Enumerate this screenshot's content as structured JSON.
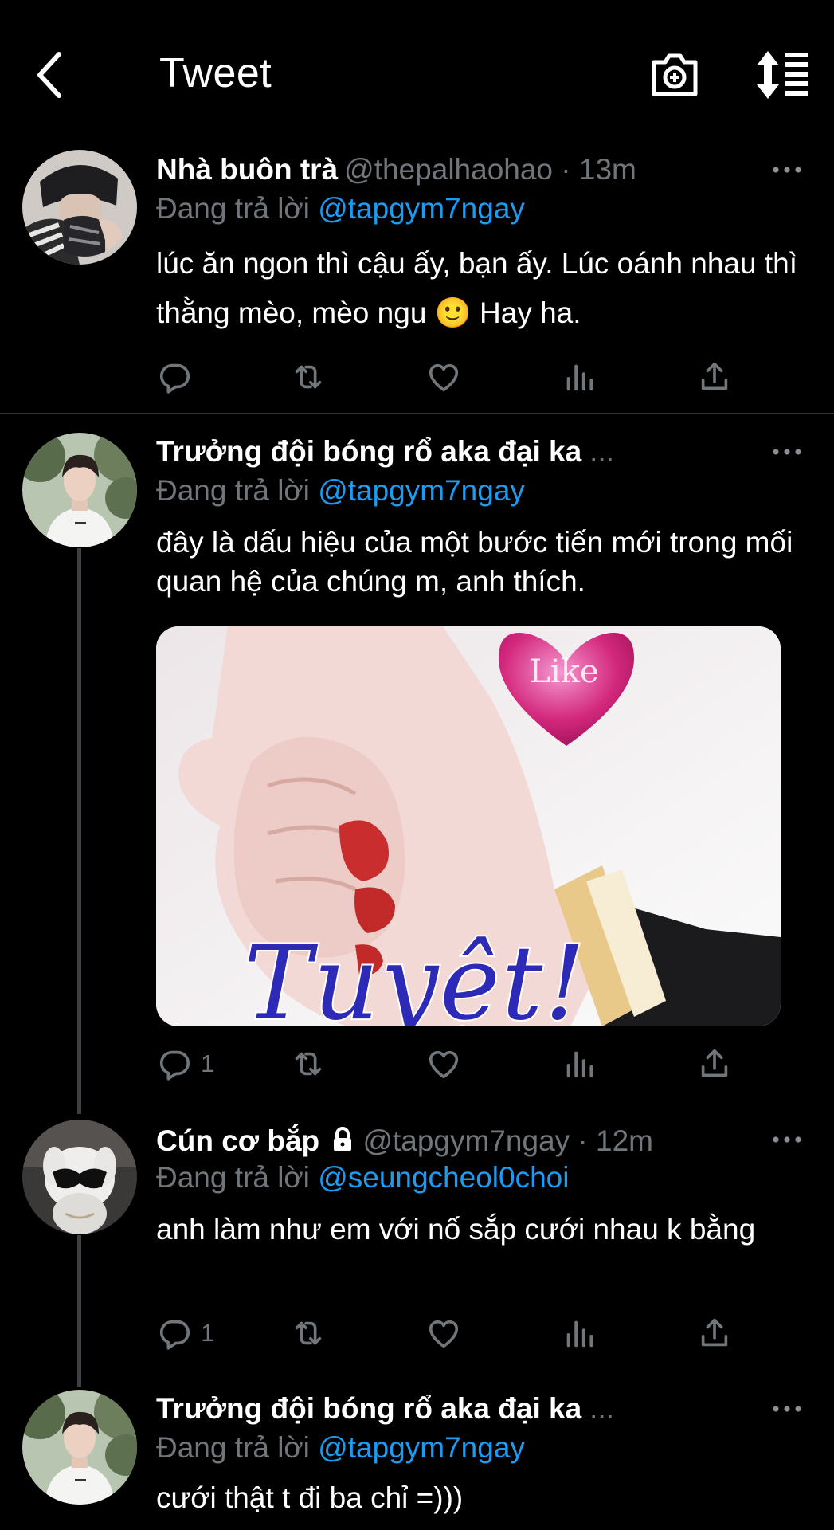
{
  "header": {
    "title": "Tweet",
    "back_icon": "chevron-left-icon",
    "camera_icon": "camera-add-icon",
    "sort_icon": "sort-list-icon"
  },
  "tweets": [
    {
      "name": "Nhà buôn trà",
      "handle": "@thepalhaohao · 13m",
      "reply_prefix": "Đang trả lời",
      "reply_to": "@tapgym7ngay",
      "text": "lúc ăn ngon thì cậu ấy, bạn ấy. Lúc oánh nhau thì thằng mèo, mèo ngu 🙂  Hay ha.",
      "reply_count": "",
      "avatar": "avatar-dark-hair"
    },
    {
      "name": "Trưởng đội bóng rổ aka đại ka",
      "handle": "...",
      "reply_prefix": "Đang trả lời",
      "reply_to": "@tapgym7ngay",
      "text": "đây là dấu hiệu của một bước tiến mới trong mối quan hệ của chúng m, anh thích.",
      "reply_count": "1",
      "avatar": "avatar-white-shirt",
      "media": {
        "heart_text": "Like",
        "script_text": "Tuyệt!",
        "icon": "thumbs-up-meme-image"
      }
    },
    {
      "name": "Cún cơ bắp",
      "handle": "@tapgym7ngay · 12m",
      "reply_prefix": "Đang trả lời",
      "reply_to": "@seungcheol0choi",
      "text": "anh làm như em với nố sắp cưới nhau k bằng",
      "reply_count": "1",
      "avatar": "avatar-white-dog",
      "lock_icon": "lock-icon"
    },
    {
      "name": "Trưởng đội bóng rổ aka đại ka",
      "handle": "...",
      "reply_prefix": "Đang trả lời",
      "reply_to": "@tapgym7ngay",
      "text": "cưới thật t đi ba chỉ =)))",
      "avatar": "avatar-white-shirt"
    }
  ],
  "colors": {
    "background": "#000000",
    "text": "#ffffff",
    "secondary": "#71767b",
    "link": "#1d9bf0",
    "thread_line": "#3e4144"
  }
}
